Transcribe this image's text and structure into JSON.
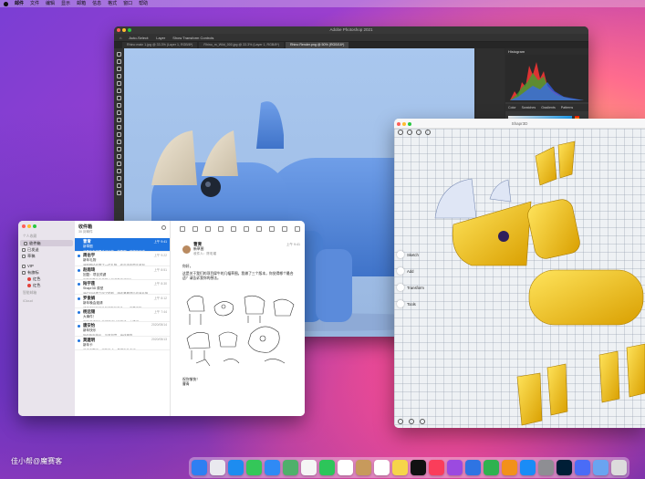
{
  "menubar": {
    "items": [
      "邮件",
      "文件",
      "编辑",
      "显示",
      "邮箱",
      "信息",
      "格式",
      "窗口",
      "帮助"
    ]
  },
  "photoshop": {
    "title": "Adobe Photoshop 2021",
    "options": [
      "Auto-Select:",
      "Layer",
      "Show Transform Controls"
    ],
    "tabs": [
      "Rhino main 1.jpg @ 33.3% (Layer 1, RGB/8*)",
      "Rhino_m_Wild_000.jpg @ 33.3% (Layer 1, RGB/8*)",
      "Rhino Render.png @ 50% (RGB/16*)"
    ],
    "panel": {
      "title": "Histogram",
      "tabs": [
        "Color",
        "Swatches",
        "Gradients",
        "Patterns"
      ]
    }
  },
  "shapr": {
    "title": "Shapr3D",
    "menu": [
      "Sketch",
      "Add",
      "Transform",
      "Tools"
    ]
  },
  "mail": {
    "sidebar": {
      "section1": "个人收藏",
      "boxes": [
        {
          "label": "收件箱",
          "selected": true
        },
        {
          "label": "已发送",
          "selected": false
        },
        {
          "label": "草稿",
          "selected": false
        }
      ],
      "section2": "",
      "tree": [
        {
          "label": "VIP",
          "red": false
        },
        {
          "label": "有旗标",
          "red": false
        },
        {
          "label": "红色",
          "red": true
        },
        {
          "label": "红色",
          "red": true
        }
      ],
      "section3": "智能邮箱",
      "section4": "iCloud"
    },
    "list_title": "收件箱",
    "list_sub": "30 封邮件",
    "messages": [
      {
        "from": "曹青",
        "time": "上午 9:41",
        "sub": "新草图",
        "snip": "这是我在城里手动画的一些草图，做得还不错",
        "selected": true
      },
      {
        "from": "周伯宇",
        "time": "上午 9:22",
        "sub": "新年礼物",
        "snip": "我刚刚给你寄了一件礼物，你应该在周五收到",
        "selected": false
      },
      {
        "from": "赵雨琦",
        "time": "上午 8:51",
        "sub": "回复：项目关键",
        "snip": "你能在周五之前把计划书发给我吗？",
        "selected": false
      },
      {
        "from": "陆宇莲",
        "time": "上午 8:30",
        "sub": "Shapr3D 原型",
        "snip": "我们已经建立好了模型，请你看看然后给我反馈",
        "selected": false
      },
      {
        "from": "罗俊娟",
        "time": "上午 8:12",
        "sub": "新年晚会邀请",
        "snip": "请来参加我们今年的新年晚会，一定要来哦",
        "selected": false
      },
      {
        "from": "杨远锡",
        "time": "上午 7:44",
        "sub": "大事件！",
        "snip": "你听说了吗？我们的设计拿奖了，太棒了",
        "selected": false
      },
      {
        "from": "唐安怡",
        "time": "2020/05/14",
        "sub": "新年快乐",
        "snip": "祝你新年快乐，万事如意，身体健康",
        "selected": false
      },
      {
        "from": "莫建明",
        "time": "2020/05/13",
        "sub": "新年卡",
        "snip": "我给你寄了一张新年卡，希望你会喜欢",
        "selected": false
      }
    ],
    "reader": {
      "from": "曹青",
      "subject": "新草图",
      "to": "收件人：陈彩瑾",
      "time": "上午 9:41",
      "greeting": "你好，",
      "body": "这是关于我们的项目犀牛的几幅草图。我做了三个版本，你觉得哪个最合适？请告诉我你的想法。",
      "sign1": "祝你愉快！",
      "sign2": "曹青"
    }
  },
  "dock": {
    "icons": [
      "finder-icon",
      "launchpad-icon",
      "safari-icon",
      "messages-icon",
      "mail-icon",
      "maps-icon",
      "photos-icon",
      "facetime-icon",
      "calendar-icon",
      "contacts-icon",
      "reminders-icon",
      "notes-icon",
      "tv-icon",
      "music-icon",
      "podcasts-icon",
      "keynote-icon",
      "numbers-icon",
      "pages-icon",
      "app-store-icon",
      "system-preferences-icon",
      "photoshop-icon",
      "shapr3d-icon",
      "downloads-icon",
      "trash-icon"
    ],
    "colors": [
      "#2e7ff2",
      "#e9e9ef",
      "#1d8cf0",
      "#34c759",
      "#2f8af5",
      "#4fb06b",
      "#f5f5f5",
      "#2dc55a",
      "#ffffff",
      "#c79a5c",
      "#ffffff",
      "#f6d54a",
      "#111111",
      "#fa3d5a",
      "#9b4ae0",
      "#2e74e3",
      "#2fb24f",
      "#f2911b",
      "#1a8cf6",
      "#8e8e93",
      "#001e36",
      "#4a6cf7",
      "#6aa4f0",
      "#dcdcdc"
    ]
  },
  "watermark": "佳小帮@魔赛客"
}
